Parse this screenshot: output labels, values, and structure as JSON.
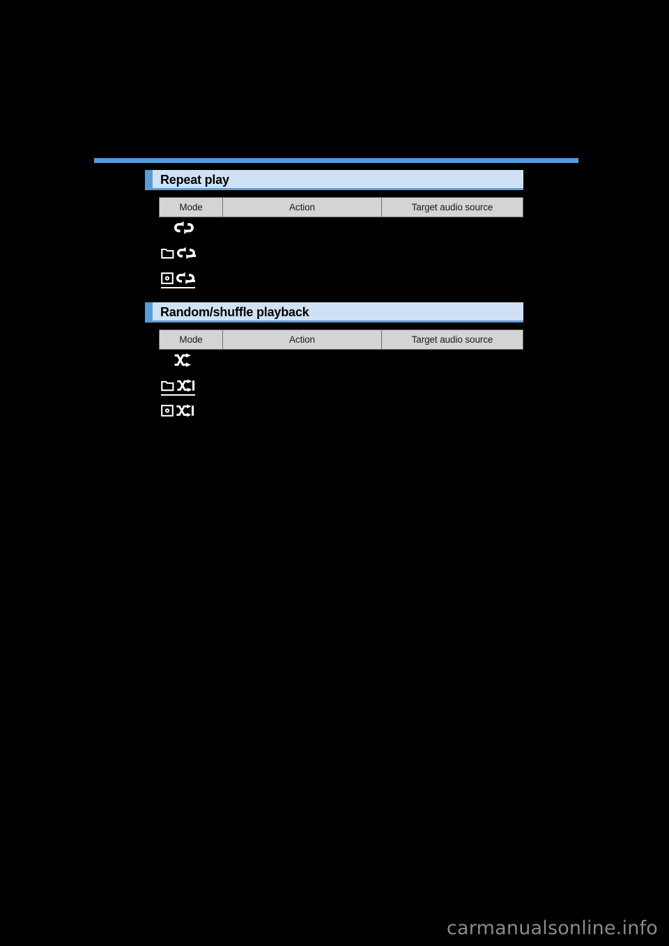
{
  "page": {
    "background_color": "#000000",
    "accent_color": "#5b9bd5",
    "banner_fill_color": "#cfe2f5",
    "table_header_color": "#d4d4d4"
  },
  "top_rule": {
    "color": "#5b9bd5"
  },
  "sections": [
    {
      "id": "repeat-play",
      "title": "Repeat play",
      "table": {
        "headers": [
          "Mode",
          "Action",
          "Target audio source"
        ],
        "rows": [
          {
            "mode_icon": "repeat-icon",
            "mode_icon_label": "repeat",
            "action": "",
            "target": ""
          },
          {
            "mode_icon": "folder-repeat-icon",
            "mode_icon_label": "folder repeat",
            "action": "",
            "target": ""
          },
          {
            "mode_icon": "disc-repeat-icon",
            "mode_icon_label": "disc repeat",
            "action": "",
            "target": ""
          }
        ]
      }
    },
    {
      "id": "random-shuffle-playback",
      "title": "Random/shuffle playback",
      "table": {
        "headers": [
          "Mode",
          "Action",
          "Target audio source"
        ],
        "rows": [
          {
            "mode_icon": "shuffle-icon",
            "mode_icon_label": "shuffle",
            "action": "",
            "target": ""
          },
          {
            "mode_icon": "folder-shuffle-icon",
            "mode_icon_label": "folder shuffle",
            "action": "",
            "target": ""
          },
          {
            "mode_icon": "disc-shuffle-icon",
            "mode_icon_label": "disc shuffle",
            "action": "",
            "target": ""
          }
        ]
      }
    }
  ],
  "watermark": {
    "text": "carmanualsonline.info",
    "color": "#8a8a8a"
  }
}
